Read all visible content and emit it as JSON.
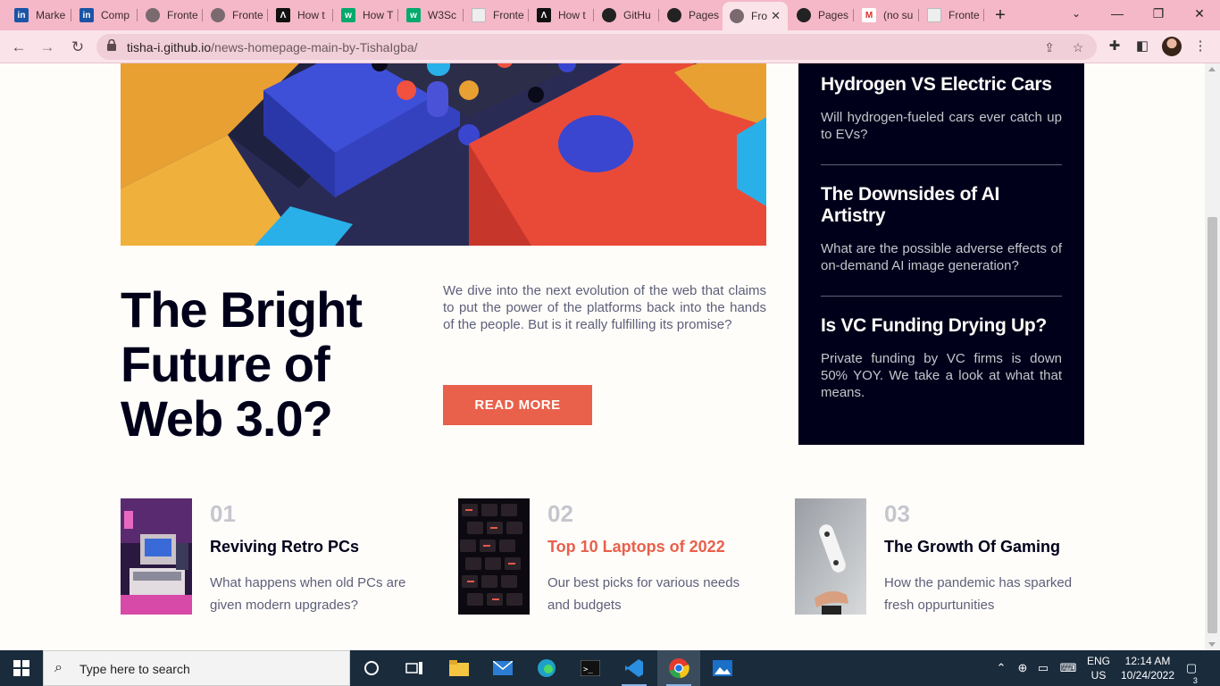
{
  "browser": {
    "tabs": [
      {
        "label": "Marke",
        "icon": "invision-icon"
      },
      {
        "label": "Comp",
        "icon": "invision-icon"
      },
      {
        "label": "Fronte",
        "icon": "globe-icon"
      },
      {
        "label": "Fronte",
        "icon": "globe-icon"
      },
      {
        "label": "How t",
        "icon": "codecademy-icon"
      },
      {
        "label": "How T",
        "icon": "w3schools-icon"
      },
      {
        "label": "W3Sc",
        "icon": "w3schools-icon"
      },
      {
        "label": "Fronte",
        "icon": "page-icon"
      },
      {
        "label": "How t",
        "icon": "codecademy-icon"
      },
      {
        "label": "GitHu",
        "icon": "github-icon"
      },
      {
        "label": "Pages",
        "icon": "github-icon"
      },
      {
        "label": "Fro",
        "icon": "globe-icon",
        "active": true
      },
      {
        "label": "Pages",
        "icon": "github-icon"
      },
      {
        "label": "(no su",
        "icon": "gmail-icon"
      },
      {
        "label": "Fronte",
        "icon": "page-icon"
      }
    ],
    "url_host": "tisha-i.github.io",
    "url_path": "/news-homepage-main-by-TishaIgba/"
  },
  "hero": {
    "title": "The Bright Future of Web 3.0?",
    "description": "We dive into the next evolution of the web that claims to put the power of the platforms back into the hands of the people. But is it really fulfilling its promise?",
    "button": "READ MORE"
  },
  "new_panel": {
    "items": [
      {
        "title": "Hydrogen VS Electric Cars",
        "desc": "Will hydrogen-fueled cars ever catch up to EVs?"
      },
      {
        "title": "The Downsides of AI Artistry",
        "desc": "What are the possible adverse effects of on-demand AI image generation?"
      },
      {
        "title": "Is VC Funding Drying Up?",
        "desc": "Private funding by VC firms is down 50% YOY. We take a look at what that means."
      }
    ]
  },
  "cards": [
    {
      "num": "01",
      "title": "Reviving Retro PCs",
      "desc": "What happens when old PCs are given modern upgrades?"
    },
    {
      "num": "02",
      "title": "Top 10 Laptops of 2022",
      "desc": "Our best picks for various needs and budgets"
    },
    {
      "num": "03",
      "title": "The Growth Of Gaming",
      "desc": "How the pandemic has sparked fresh oppurtunities"
    }
  ],
  "taskbar": {
    "search_placeholder": "Type here to search",
    "lang_line1": "ENG",
    "lang_line2": "US",
    "time": "12:14 AM",
    "date": "10/24/2022",
    "notifications": "3"
  },
  "colors": {
    "accent": "#e9604b",
    "dark": "#00001a",
    "muted": "#5d5f79",
    "page_bg": "#fffdfa",
    "browser_frame": "#f5b8c8"
  }
}
